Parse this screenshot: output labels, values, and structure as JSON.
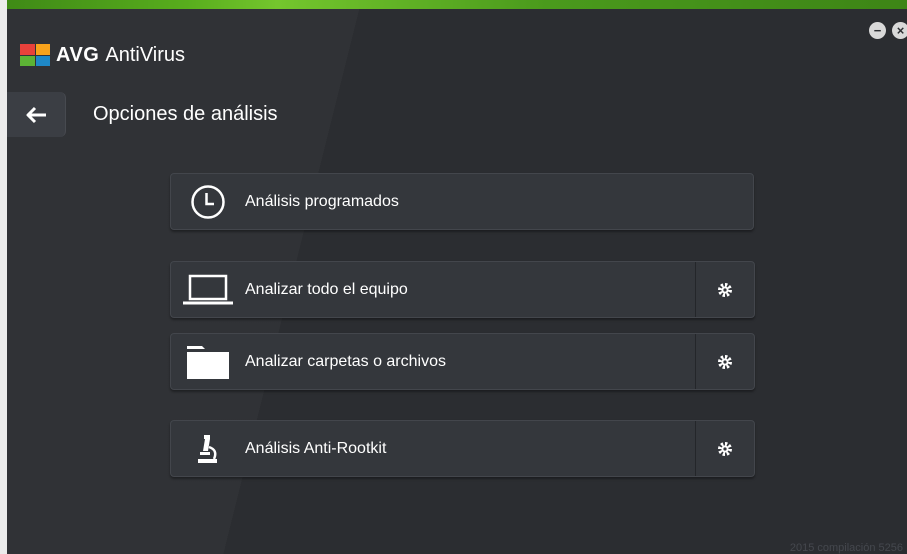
{
  "app": {
    "brand": "AVG",
    "name": "AntiVirus",
    "logo_colors": [
      "#e8413b",
      "#f7a21b",
      "#5cb335",
      "#1e88c7"
    ]
  },
  "window": {
    "minimize_icon": "−",
    "close_icon": "×"
  },
  "header": {
    "back_icon": "arrow-left-icon",
    "title": "Opciones de análisis"
  },
  "scans": [
    {
      "label": "Análisis programados",
      "icon": "clock-icon",
      "has_settings": false
    },
    {
      "label": "Analizar todo el equipo",
      "icon": "laptop-icon",
      "has_settings": true
    },
    {
      "label": "Analizar carpetas o archivos",
      "icon": "folder-icon",
      "has_settings": true
    },
    {
      "label": "Análisis Anti-Rootkit",
      "icon": "microscope-icon",
      "has_settings": true
    }
  ],
  "footer": {
    "build": "2015  compilación 5256"
  },
  "colors": {
    "background": "#2b2d31",
    "button": "#34373c",
    "accent_green": "#58ad1d",
    "text": "#ffffff"
  }
}
